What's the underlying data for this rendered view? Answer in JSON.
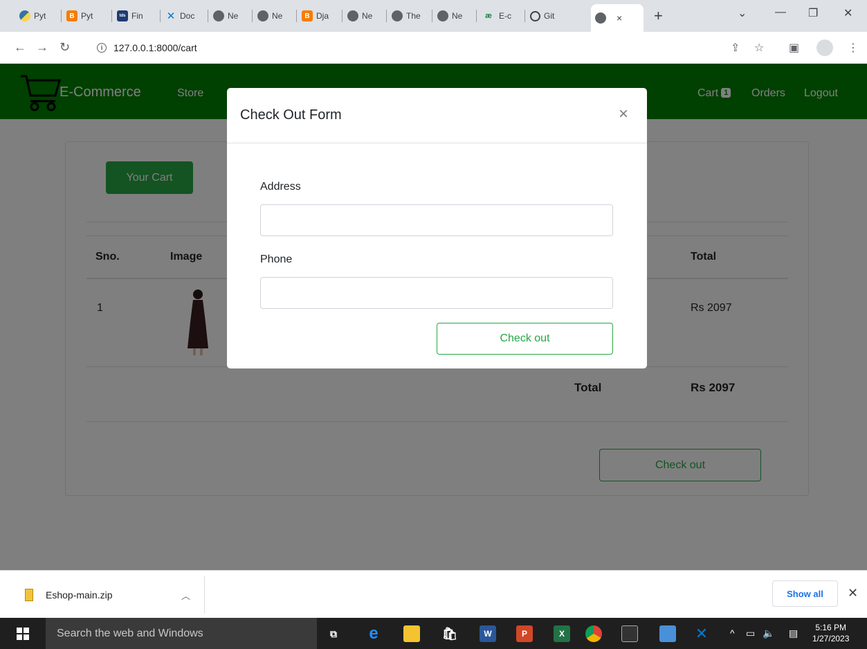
{
  "browser": {
    "tabs": [
      {
        "title": "Pyt",
        "icon": "python-icon"
      },
      {
        "title": "Pyt",
        "icon": "blogger-icon"
      },
      {
        "title": "Fin",
        "icon": "tds-icon"
      },
      {
        "title": "Doc",
        "icon": "vscode-icon"
      },
      {
        "title": "Ne",
        "icon": "globe-icon"
      },
      {
        "title": "Ne",
        "icon": "globe-icon"
      },
      {
        "title": "Dja",
        "icon": "blogger-icon"
      },
      {
        "title": "Ne",
        "icon": "globe-icon"
      },
      {
        "title": "The",
        "icon": "globe-icon"
      },
      {
        "title": "Ne",
        "icon": "globe-icon"
      },
      {
        "title": "E-c",
        "icon": "ae-icon"
      },
      {
        "title": "Git",
        "icon": "github-icon"
      }
    ],
    "active_tab_close": "×",
    "new_tab": "+",
    "url": "127.0.0.1:8000/cart"
  },
  "site": {
    "brand": "E-Commerce",
    "nav": {
      "store": "Store",
      "cart": "Cart",
      "cart_count": "1",
      "orders": "Orders",
      "logout": "Logout"
    },
    "colors": {
      "navbar": "#008000",
      "accent": "#28a745"
    }
  },
  "cart": {
    "title_button": "Your Cart",
    "headers": {
      "sno": "Sno.",
      "image": "Image",
      "total": "Total"
    },
    "rows": [
      {
        "sno": "1",
        "total": "Rs 2097"
      }
    ],
    "total_label": "Total",
    "total_value": "Rs 2097",
    "checkout_button": "Check out"
  },
  "modal": {
    "title": "Check Out Form",
    "close": "×",
    "address_label": "Address",
    "address_value": "",
    "phone_label": "Phone",
    "phone_value": "",
    "submit": "Check out"
  },
  "downloads": {
    "file": "Eshop-main.zip",
    "show_all": "Show all"
  },
  "taskbar": {
    "search_placeholder": "Search the web and Windows",
    "time": "5:16 PM",
    "date": "1/27/2023"
  }
}
